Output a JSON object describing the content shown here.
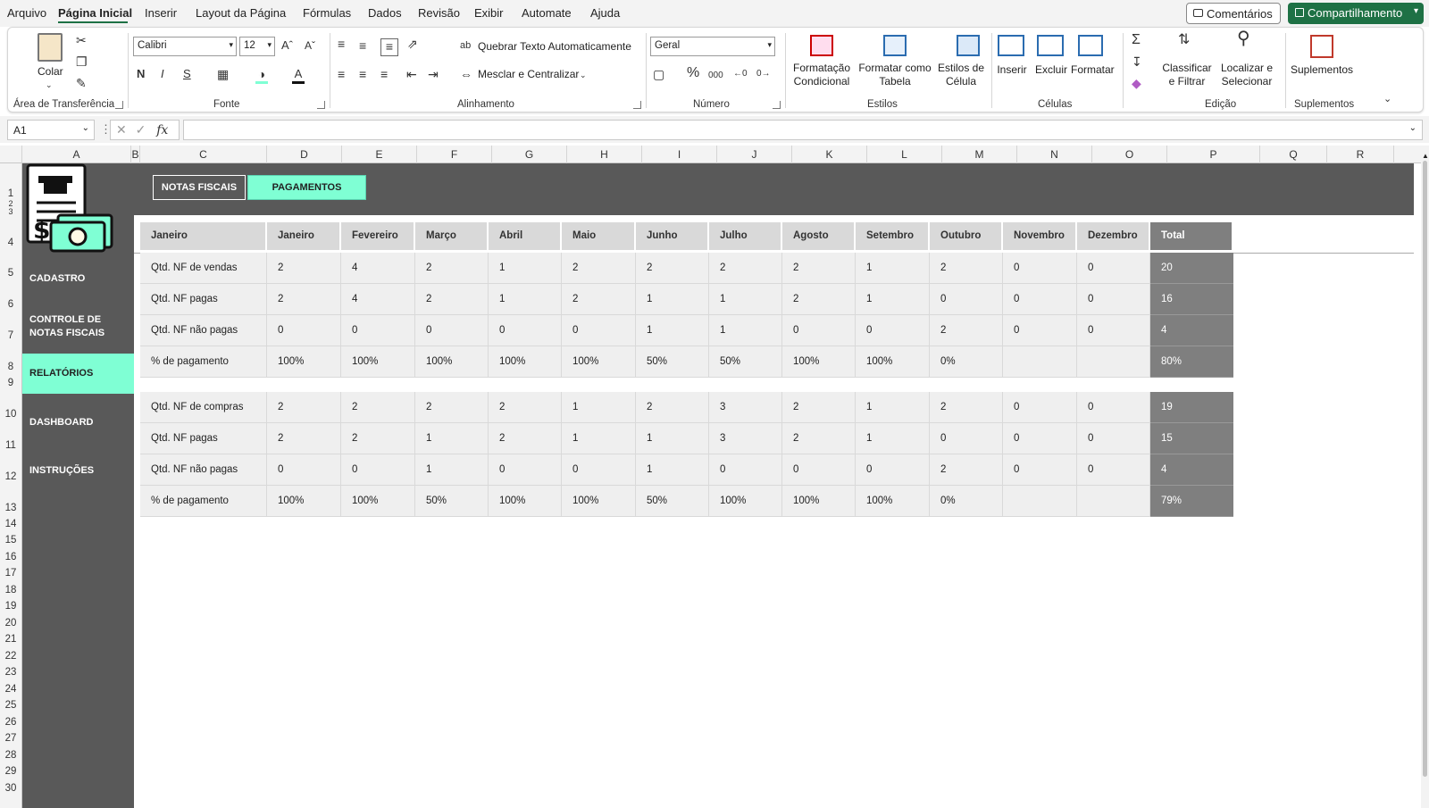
{
  "menu": {
    "items": [
      "Arquivo",
      "Página Inicial",
      "Inserir",
      "Layout da Página",
      "Fórmulas",
      "Dados",
      "Revisão",
      "Exibir",
      "Automate",
      "Ajuda"
    ],
    "comments": "Comentários",
    "share": "Compartilhamento"
  },
  "ribbon": {
    "clipboard": {
      "paste": "Colar",
      "label": "Área de Transferência"
    },
    "font": {
      "name": "Calibri",
      "size": "12",
      "bold": "N",
      "italic": "I",
      "underline": "S",
      "label": "Fonte"
    },
    "alignment": {
      "wrap": "Quebrar Texto Automaticamente",
      "merge": "Mesclar e Centralizar",
      "label": "Alinhamento"
    },
    "number": {
      "format": "Geral",
      "percent": "%",
      "thousands": "000",
      "label": "Número"
    },
    "styles": {
      "cond1": "Formatação",
      "cond2": "Condicional",
      "table1": "Formatar como",
      "table2": "Tabela",
      "cell1": "Estilos de",
      "cell2": "Célula",
      "label": "Estilos"
    },
    "cells": {
      "insert": "Inserir",
      "delete": "Excluir",
      "format": "Formatar",
      "label": "Células"
    },
    "editing": {
      "sort1": "Classificar",
      "sort2": "e Filtrar",
      "find1": "Localizar e",
      "find2": "Selecionar",
      "label": "Edição"
    },
    "addins": {
      "btn": "Suplementos",
      "label": "Suplementos"
    }
  },
  "formula_bar": {
    "name_box": "A1",
    "fx": "fx",
    "value": ""
  },
  "columns": [
    "A",
    "B",
    "C",
    "D",
    "E",
    "F",
    "G",
    "H",
    "I",
    "J",
    "K",
    "L",
    "M",
    "N",
    "O",
    "P",
    "Q",
    "R"
  ],
  "rows": [
    "1",
    "2",
    "3",
    "4",
    "5",
    "6",
    "7",
    "8",
    "9",
    "10",
    "11",
    "12",
    "13",
    "14",
    "15",
    "16",
    "17",
    "18",
    "19",
    "20",
    "21",
    "22",
    "23",
    "24",
    "25",
    "26",
    "27",
    "28",
    "29",
    "30"
  ],
  "sidebar": {
    "items": [
      "CADASTRO",
      "CONTROLE DE NOTAS FISCAIS",
      "RELATÓRIOS",
      "DASHBOARD",
      "INSTRUÇÕES"
    ],
    "active": "RELATÓRIOS"
  },
  "tabs": {
    "notas": "NOTAS FISCAIS",
    "pagamentos": "PAGAMENTOS"
  },
  "report": {
    "headers": [
      "Janeiro",
      "Janeiro",
      "Fevereiro",
      "Março",
      "Abril",
      "Maio",
      "Junho",
      "Julho",
      "Agosto",
      "Setembro",
      "Outubro",
      "Novembro",
      "Dezembro",
      "Total"
    ],
    "sales": [
      {
        "label": "Qtd. NF de vendas",
        "values": [
          "2",
          "4",
          "2",
          "1",
          "2",
          "2",
          "2",
          "2",
          "1",
          "2",
          "0",
          "0"
        ],
        "total": "20"
      },
      {
        "label": "Qtd. NF pagas",
        "values": [
          "2",
          "4",
          "2",
          "1",
          "2",
          "1",
          "1",
          "2",
          "1",
          "0",
          "0",
          "0"
        ],
        "total": "16"
      },
      {
        "label": "Qtd. NF não pagas",
        "values": [
          "0",
          "0",
          "0",
          "0",
          "0",
          "1",
          "1",
          "0",
          "0",
          "2",
          "0",
          "0"
        ],
        "total": "4"
      },
      {
        "label": "% de pagamento",
        "values": [
          "100%",
          "100%",
          "100%",
          "100%",
          "100%",
          "50%",
          "50%",
          "100%",
          "100%",
          "0%",
          "",
          ""
        ],
        "total": "80%"
      }
    ],
    "purchases": [
      {
        "label": "Qtd. NF de compras",
        "values": [
          "2",
          "2",
          "2",
          "2",
          "1",
          "2",
          "3",
          "2",
          "1",
          "2",
          "0",
          "0"
        ],
        "total": "19"
      },
      {
        "label": "Qtd. NF pagas",
        "values": [
          "2",
          "2",
          "1",
          "2",
          "1",
          "1",
          "3",
          "2",
          "1",
          "0",
          "0",
          "0"
        ],
        "total": "15"
      },
      {
        "label": "Qtd. NF não pagas",
        "values": [
          "0",
          "0",
          "1",
          "0",
          "0",
          "1",
          "0",
          "0",
          "0",
          "2",
          "0",
          "0"
        ],
        "total": "4"
      },
      {
        "label": "% de pagamento",
        "values": [
          "100%",
          "100%",
          "50%",
          "100%",
          "100%",
          "50%",
          "100%",
          "100%",
          "100%",
          "0%",
          "",
          ""
        ],
        "total": "79%"
      }
    ]
  },
  "colors": {
    "accent": "#7fffd4",
    "panel": "#595959",
    "total": "#7f7f7f",
    "excel_green": "#1e7145"
  }
}
